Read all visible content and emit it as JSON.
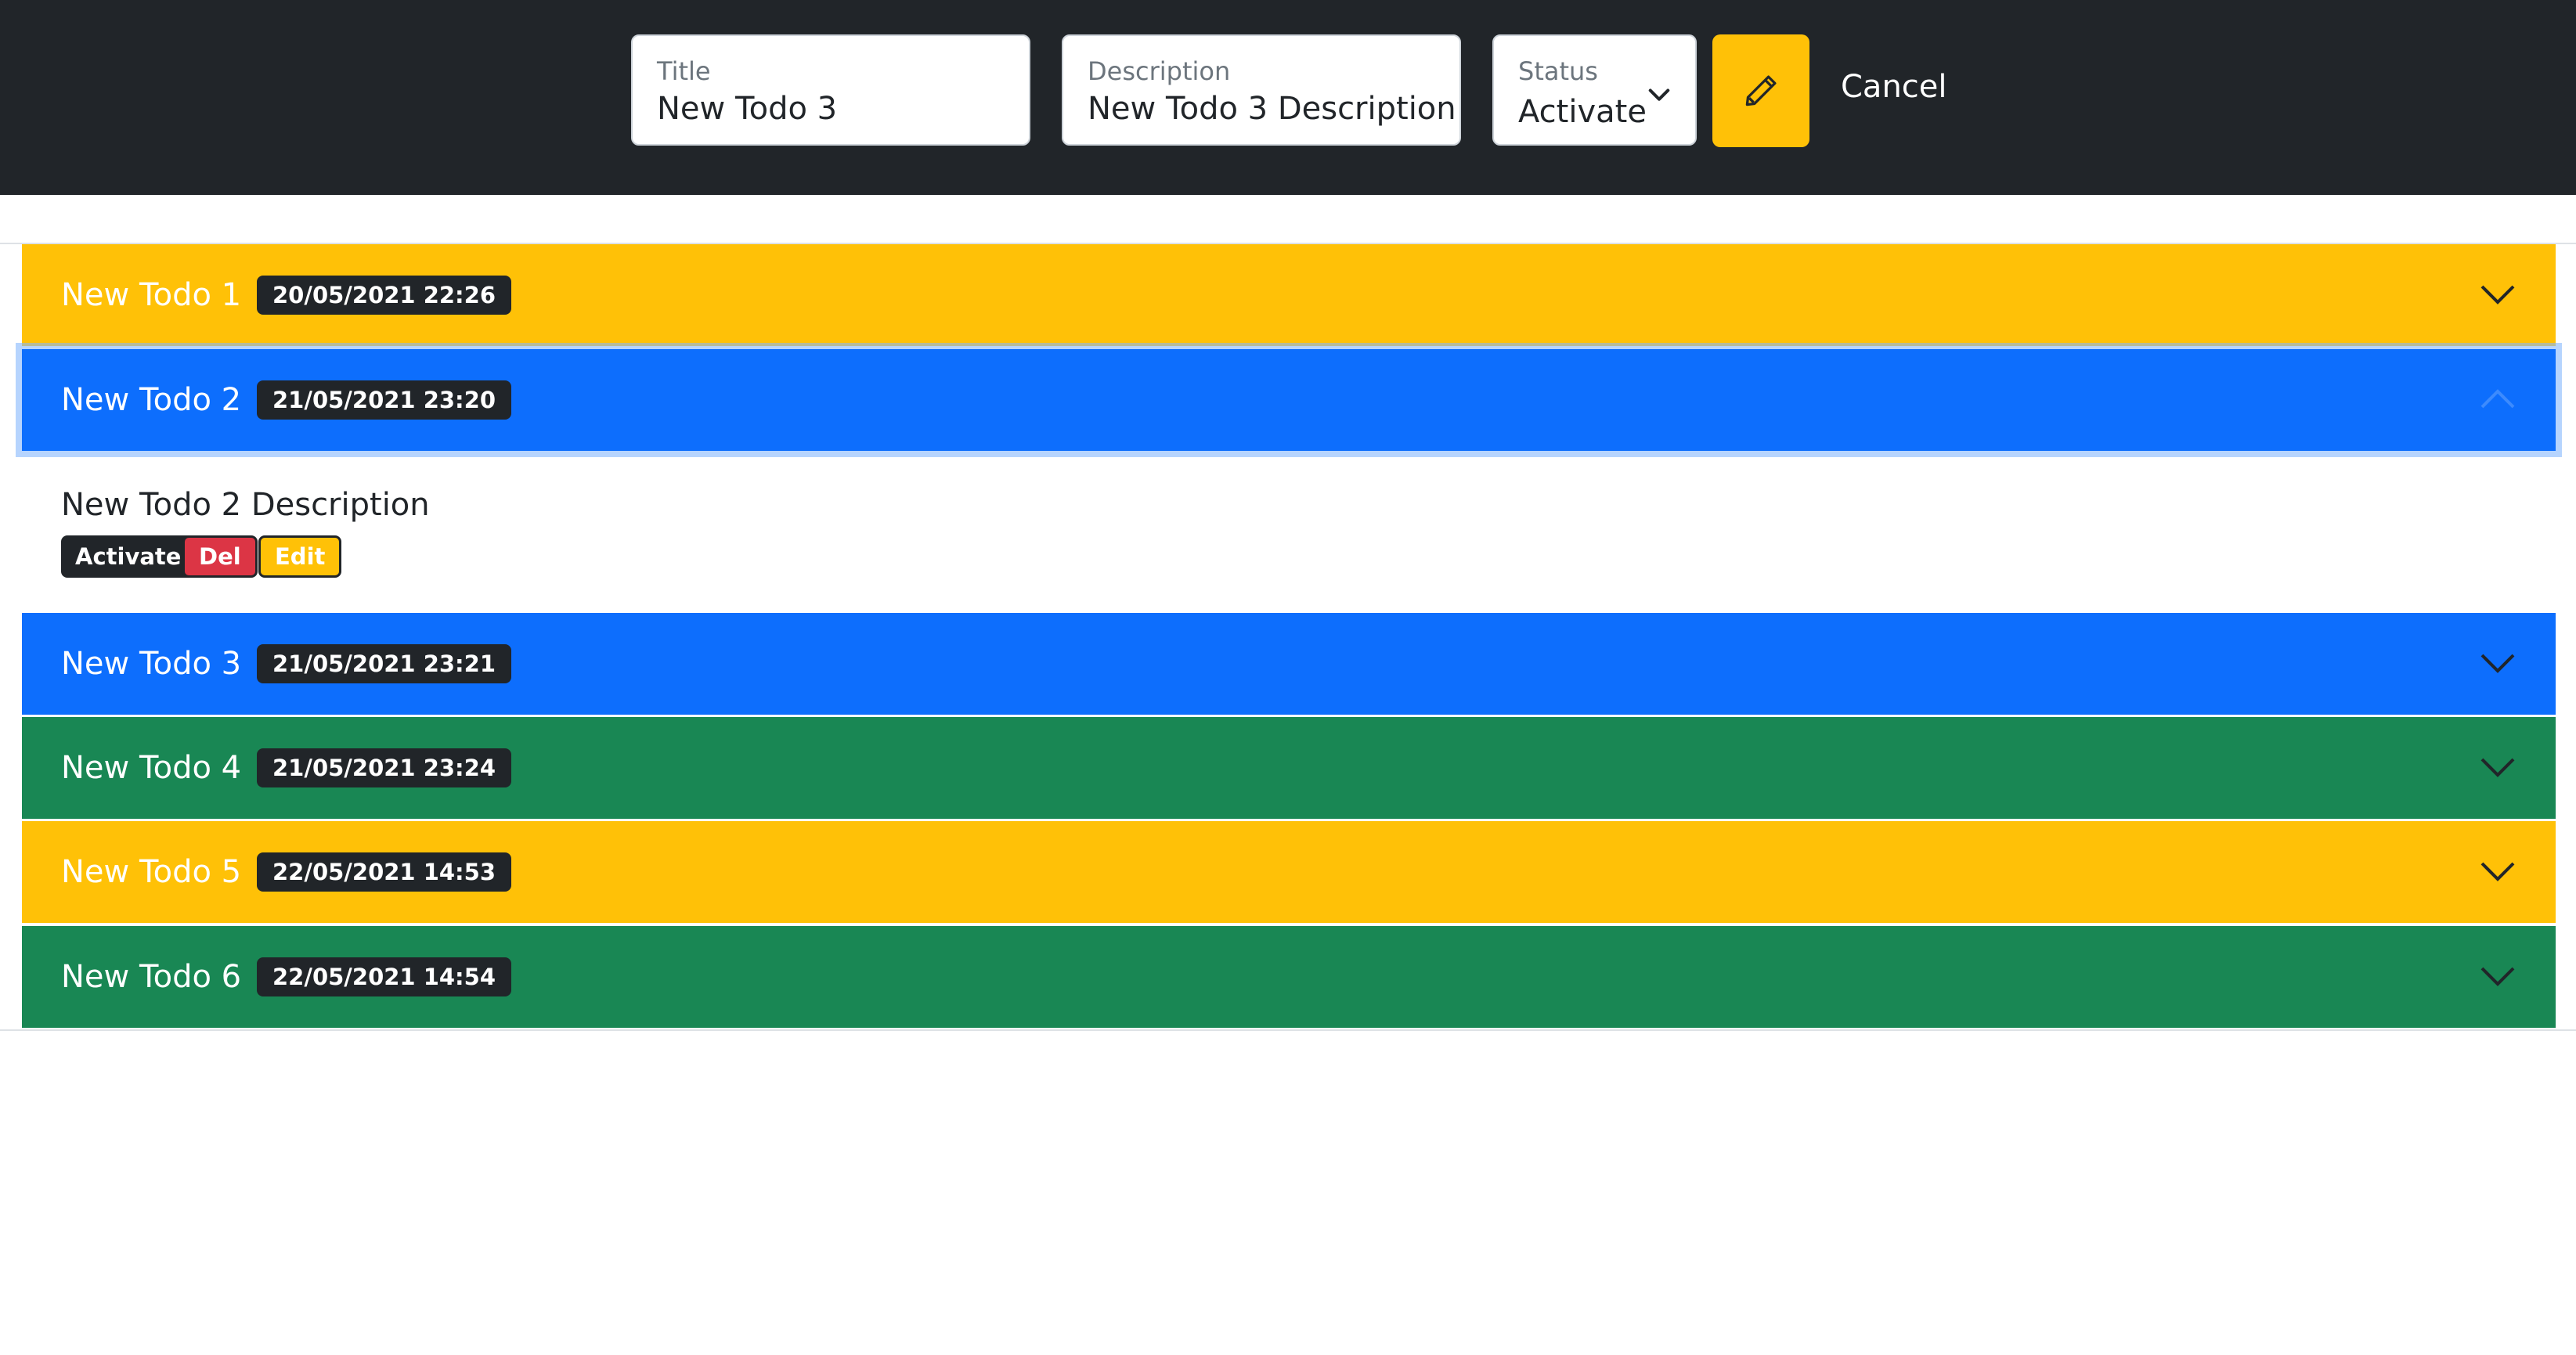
{
  "form": {
    "title_label": "Title",
    "title_value": "New Todo 3",
    "description_label": "Description",
    "description_value": "New Todo 3 Description",
    "status_label": "Status",
    "status_value": "Activate",
    "edit_icon": "pencil-icon",
    "cancel_label": "Cancel"
  },
  "todos": [
    {
      "title": "New Todo 1",
      "date": "20/05/2021 22:26",
      "color": "#ffc107",
      "expanded": false
    },
    {
      "title": "New Todo 2",
      "date": "21/05/2021 23:20",
      "color": "#0d6efd",
      "expanded": true
    },
    {
      "title": "New Todo 3",
      "date": "21/05/2021 23:21",
      "color": "#0d6efd",
      "expanded": false
    },
    {
      "title": "New Todo 4",
      "date": "21/05/2021 23:24",
      "color": "#198754",
      "expanded": false
    },
    {
      "title": "New Todo 5",
      "date": "22/05/2021 14:53",
      "color": "#ffc107",
      "expanded": false
    },
    {
      "title": "New Todo 6",
      "date": "22/05/2021 14:54",
      "color": "#198754",
      "expanded": false
    }
  ],
  "expanded_body": {
    "description": "New Todo 2 Description",
    "activate_label": "Activate",
    "delete_label": "Del",
    "edit_label": "Edit"
  },
  "colors": {
    "navbar": "#212529",
    "warning": "#ffc107",
    "primary": "#0d6efd",
    "success": "#198754",
    "danger": "#dc3545"
  }
}
